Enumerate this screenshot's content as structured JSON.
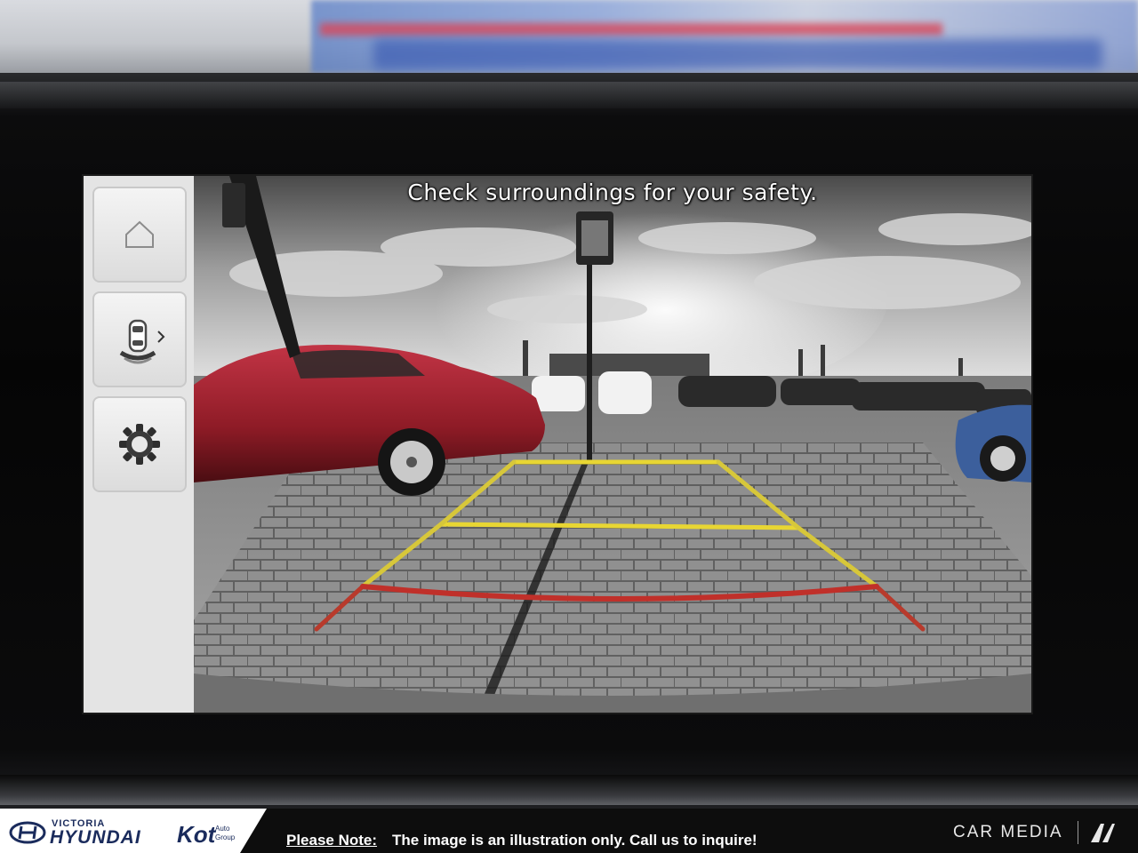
{
  "camera": {
    "notice": "Check surroundings for your safety."
  },
  "sidebar": {
    "items": [
      {
        "icon": "home-icon"
      },
      {
        "icon": "parking-sensor-view-icon"
      },
      {
        "icon": "settings-gear-icon"
      }
    ]
  },
  "footer": {
    "dealer_line1": "VICTORIA",
    "dealer_line2": "HYUNDAI",
    "group_logo": "Kot",
    "group_sub1": "Auto",
    "group_sub2": "Group",
    "note_label": "Please Note:",
    "note_text": "The image is an illustration only. Call us to inquire!",
    "carmedia": "CAR MEDIA"
  },
  "colors": {
    "guide_yellow": "#e8d633",
    "guide_red": "#c0302a",
    "car_red": "#a3202a"
  }
}
